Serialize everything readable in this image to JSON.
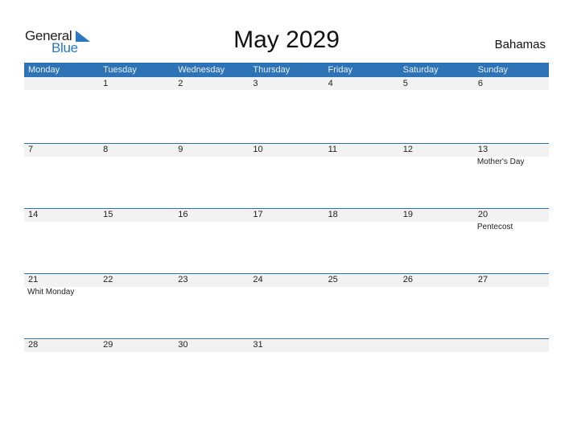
{
  "logo": {
    "text1": "General",
    "text2": "Blue"
  },
  "title": "May 2029",
  "country": "Bahamas",
  "colors": {
    "header_bg": "#2e73b5",
    "brand_blue": "#2a78c2",
    "daybar_bg": "#f2f2f2"
  },
  "weekdays": [
    "Monday",
    "Tuesday",
    "Wednesday",
    "Thursday",
    "Friday",
    "Saturday",
    "Sunday"
  ],
  "weeks": [
    [
      {
        "day": ""
      },
      {
        "day": "1"
      },
      {
        "day": "2"
      },
      {
        "day": "3"
      },
      {
        "day": "4"
      },
      {
        "day": "5"
      },
      {
        "day": "6"
      }
    ],
    [
      {
        "day": "7"
      },
      {
        "day": "8"
      },
      {
        "day": "9"
      },
      {
        "day": "10"
      },
      {
        "day": "11"
      },
      {
        "day": "12"
      },
      {
        "day": "13",
        "event": "Mother's Day"
      }
    ],
    [
      {
        "day": "14"
      },
      {
        "day": "15"
      },
      {
        "day": "16"
      },
      {
        "day": "17"
      },
      {
        "day": "18"
      },
      {
        "day": "19"
      },
      {
        "day": "20",
        "event": "Pentecost"
      }
    ],
    [
      {
        "day": "21",
        "event": "Whit Monday"
      },
      {
        "day": "22"
      },
      {
        "day": "23"
      },
      {
        "day": "24"
      },
      {
        "day": "25"
      },
      {
        "day": "26"
      },
      {
        "day": "27"
      }
    ],
    [
      {
        "day": "28"
      },
      {
        "day": "29"
      },
      {
        "day": "30"
      },
      {
        "day": "31"
      },
      {
        "day": ""
      },
      {
        "day": ""
      },
      {
        "day": ""
      }
    ]
  ]
}
